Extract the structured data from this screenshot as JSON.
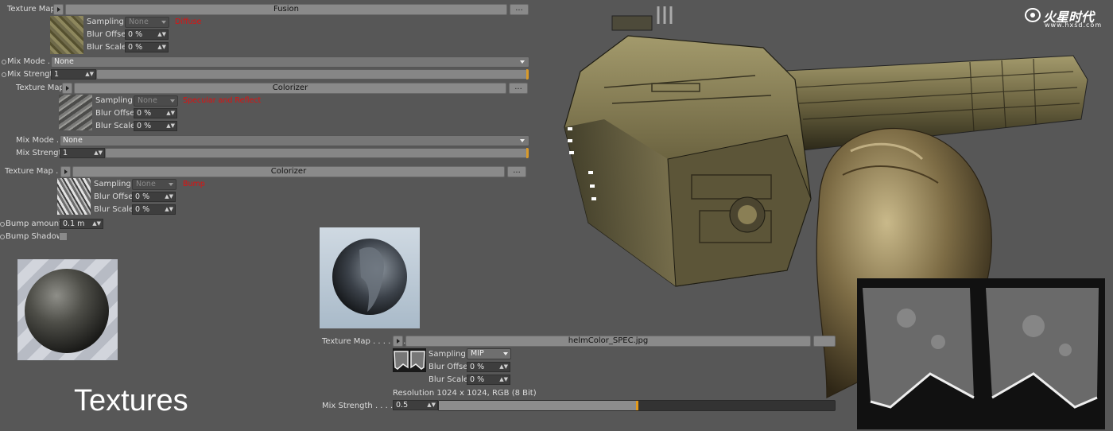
{
  "logo": {
    "text": "火星时代",
    "url": "www.hxsd.com"
  },
  "top": {
    "texture_map_label": "Texture Map",
    "shader_name": "Fusion",
    "dots": "...",
    "sampling_label": "Sampling",
    "sampling_value": "None",
    "blur_offset_label": "Blur Offset",
    "blur_offset_value": "0 %",
    "blur_scale_label": "Blur Scale",
    "blur_scale_value": "0 %",
    "note": "Diffuse",
    "mix_mode_label": "Mix Mode . .",
    "mix_mode_value": "None",
    "mix_strength_label": "Mix Strength",
    "mix_strength_value": "1"
  },
  "layer2": {
    "texture_map_label": "Texture Map",
    "shader_name": "Colorizer",
    "dots": "...",
    "sampling_label": "Sampling",
    "sampling_value": "None",
    "blur_offset_label": "Blur Offset",
    "blur_offset_value": "0 %",
    "blur_scale_label": "Blur Scale",
    "blur_scale_value": "0 %",
    "note": "Specular and Reflect",
    "mix_mode_label": "Mix Mode . .",
    "mix_mode_value": "None",
    "mix_strength_label": "Mix Strength",
    "mix_strength_value": "1"
  },
  "layer3": {
    "texture_map_label": "Texture Map . . .",
    "shader_name": "Colorizer",
    "dots": "...",
    "sampling_label": "Sampling",
    "sampling_value": "None",
    "blur_offset_label": "Blur Offset",
    "blur_offset_value": "0 %",
    "blur_scale_label": "Blur Scale",
    "blur_scale_value": "0 %",
    "note": "Bump",
    "bump_amount_label": "Bump amount",
    "bump_amount_value": "0.1 m",
    "bump_shadows_label": "Bump Shadows"
  },
  "bottom": {
    "texture_map_label": "Texture Map . . . . . . .",
    "file_name": "helmColor_SPEC.jpg",
    "sampling_label": "Sampling",
    "sampling_value": "MIP",
    "blur_offset_label": "Blur Offset",
    "blur_offset_value": "0 %",
    "blur_scale_label": "Blur Scale",
    "blur_scale_value": "0 %",
    "resolution": "Resolution  1024 x 1024, RGB (8 Bit)",
    "mix_strength_label": "Mix Strength . . . . . . .",
    "mix_strength_value": "0.5",
    "mix_strength_fraction": 0.5
  },
  "title": "Textures",
  "colors": {
    "background": "#575757",
    "note_red": "#e01010",
    "slider_orange": "#d89a2a"
  }
}
